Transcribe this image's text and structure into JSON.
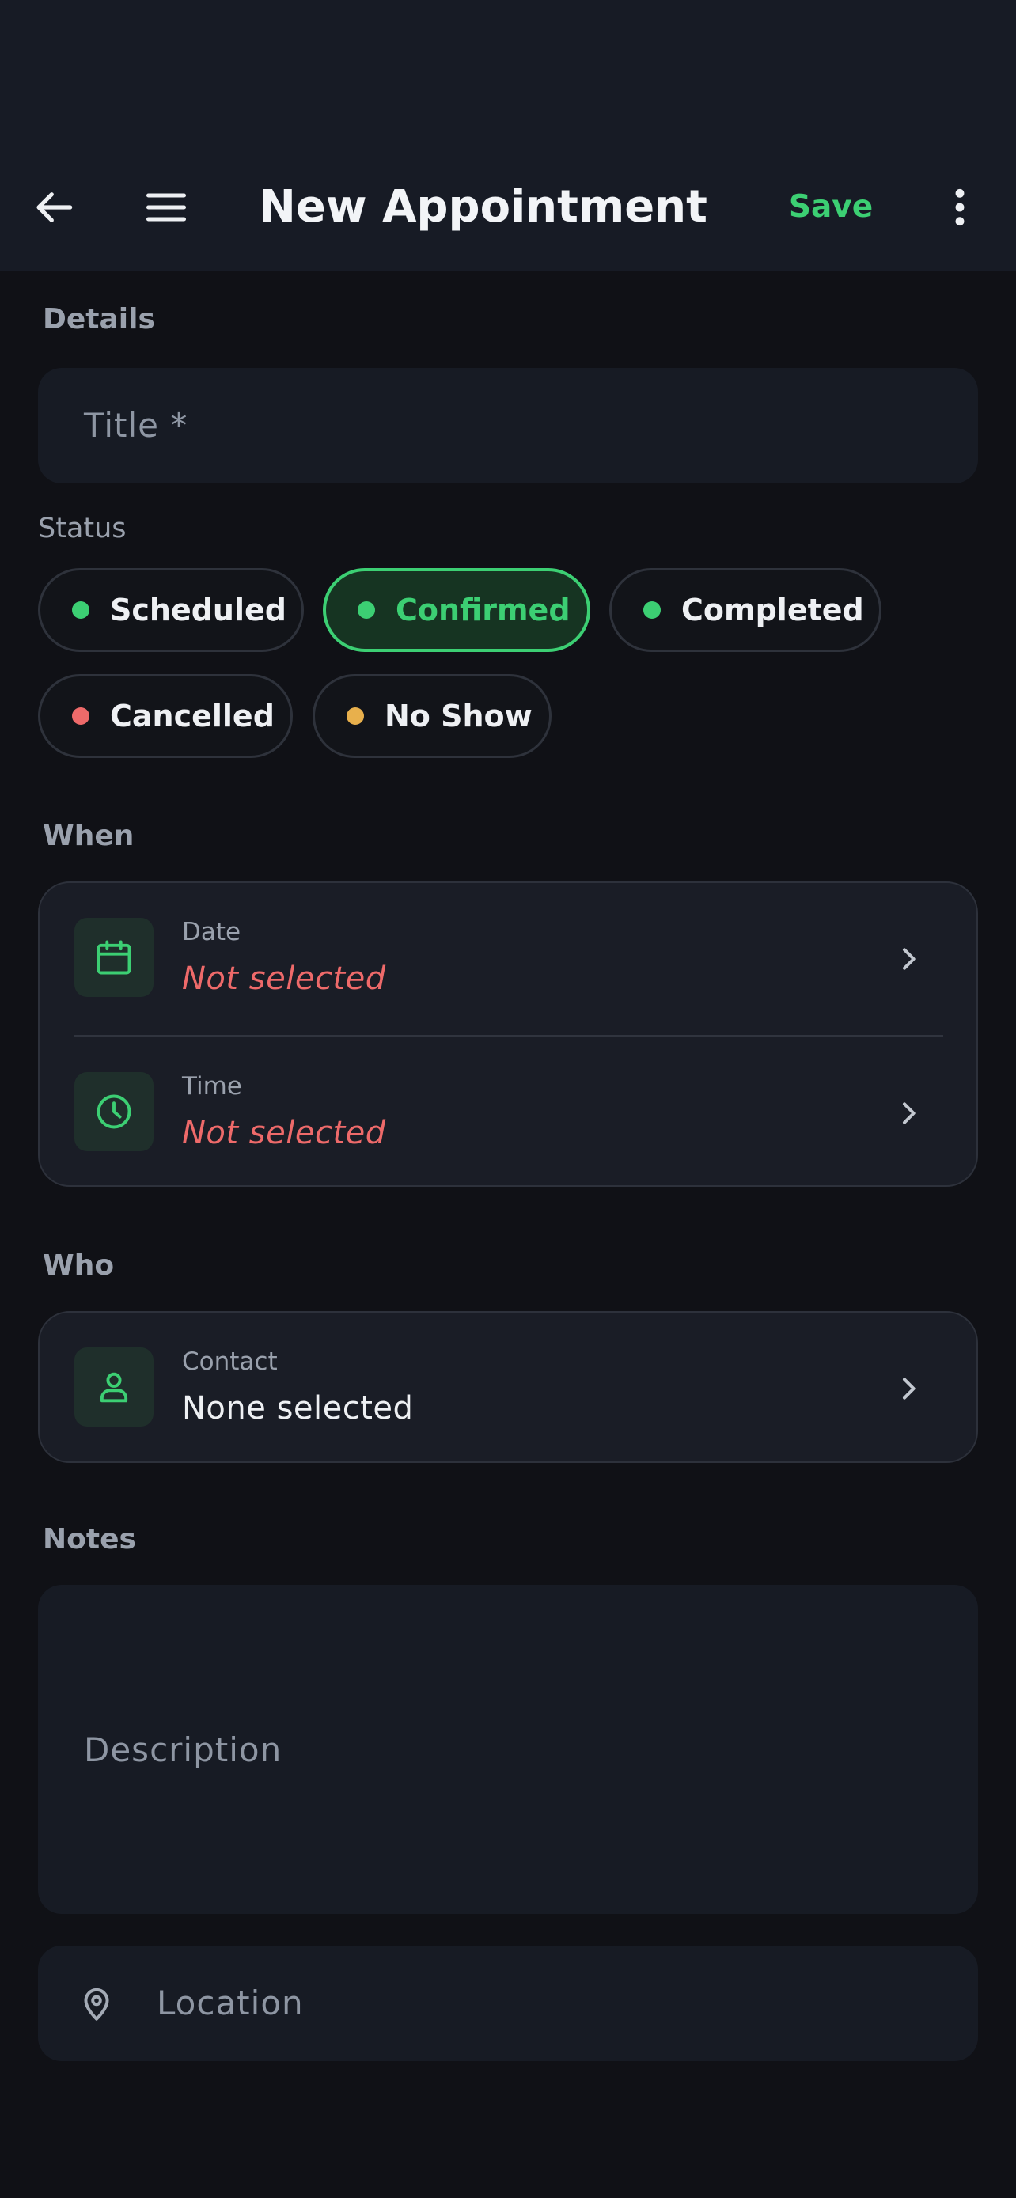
{
  "header": {
    "back_icon": "arrow-left-icon",
    "menu_icon": "hamburger-menu-icon",
    "title": "New Appointment",
    "save_label": "Save",
    "more_icon": "more-vertical-icon"
  },
  "details": {
    "section_label": "Details",
    "title_placeholder": "Title *",
    "title_value": ""
  },
  "status": {
    "label": "Status",
    "selected": "Confirmed",
    "options": [
      {
        "label": "Scheduled",
        "color": "#3ccf73"
      },
      {
        "label": "Confirmed",
        "color": "#3ccf73"
      },
      {
        "label": "Completed",
        "color": "#3ccf73"
      },
      {
        "label": "Cancelled",
        "color": "#ee6a6a"
      },
      {
        "label": "No Show",
        "color": "#e8b04c"
      }
    ]
  },
  "when": {
    "section_label": "When",
    "date": {
      "icon": "calendar-icon",
      "label": "Date",
      "value": "Not selected"
    },
    "time": {
      "icon": "clock-icon",
      "label": "Time",
      "value": "Not selected"
    }
  },
  "who": {
    "section_label": "Who",
    "contact": {
      "icon": "user-icon",
      "label": "Contact",
      "value": "None selected"
    }
  },
  "notes": {
    "section_label": "Notes",
    "description_placeholder": "Description",
    "location_icon": "map-pin-icon",
    "location_placeholder": "Location"
  },
  "colors": {
    "accent": "#3ccf73",
    "error": "#ee6a6a",
    "warning": "#e8b04c",
    "background": "#101116",
    "surface": "#1a1d26"
  }
}
